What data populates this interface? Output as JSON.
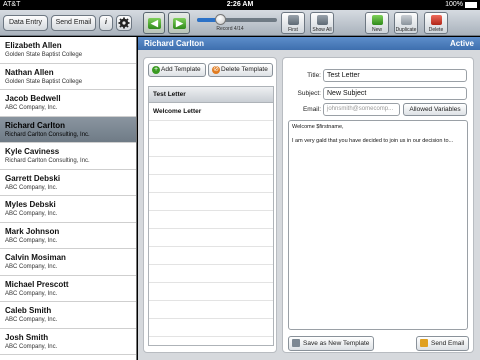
{
  "status_bar": {
    "carrier": "AT&T",
    "time": "2:26 AM",
    "battery": "100%"
  },
  "toolbar": {
    "data_entry_label": "Data Entry",
    "send_email_label": "Send Email",
    "info_label": "i",
    "record_label": "Record 4/14",
    "record_progress": 0.29,
    "first_label": "First",
    "show_all_label": "Show All",
    "new_label": "New",
    "duplicate_label": "Duplicate",
    "delete_label": "Delete"
  },
  "sidebar": {
    "items": [
      {
        "name": "Elizabeth Allen",
        "company": "Golden State Baptist College"
      },
      {
        "name": "Nathan Allen",
        "company": "Golden State Baptist College"
      },
      {
        "name": "Jacob Bedwell",
        "company": "ABC Company, Inc."
      },
      {
        "name": "Richard Carlton",
        "company": "Richard Carlton Consulting, Inc."
      },
      {
        "name": "Kyle Caviness",
        "company": "Richard Carlton Consulting, Inc."
      },
      {
        "name": "Garrett Debski",
        "company": "ABC Company, Inc."
      },
      {
        "name": "Myles Debski",
        "company": "ABC Company, Inc."
      },
      {
        "name": "Mark Johnson",
        "company": "ABC Company, Inc."
      },
      {
        "name": "Calvin Mosiman",
        "company": "ABC Company, Inc."
      },
      {
        "name": "Michael Prescott",
        "company": "ABC Company, Inc."
      },
      {
        "name": "Caleb Smith",
        "company": "ABC Company, Inc."
      },
      {
        "name": "Josh Smith",
        "company": "ABC Company, Inc."
      }
    ],
    "selected_index": 3
  },
  "detail": {
    "header_name": "Richard Carlton",
    "status": "Active",
    "add_template_label": "Add Template",
    "delete_template_label": "Delete Template",
    "template_list": {
      "header": "Test Letter",
      "rows": [
        "Welcome Letter"
      ]
    },
    "form": {
      "title_label": "Title:",
      "title_value": "Test Letter",
      "subject_label": "Subject:",
      "subject_value": "New Subject",
      "email_label": "Email:",
      "email_placeholder": "johnsmith@somecomp...",
      "allowed_variables_label": "Allowed Variables",
      "body_line1": "Welcome $firstname,",
      "body_line2": "I am very gald that you have decided to join us in our decision to..."
    },
    "save_as_new_template_label": "Save as New Template",
    "send_email_label": "Send Email"
  },
  "colors": {
    "header_blue": "#4a7dbd",
    "selected_row": "#7d8893",
    "accent_green": "#3a9a22",
    "delete_red": "#c43a2e"
  }
}
